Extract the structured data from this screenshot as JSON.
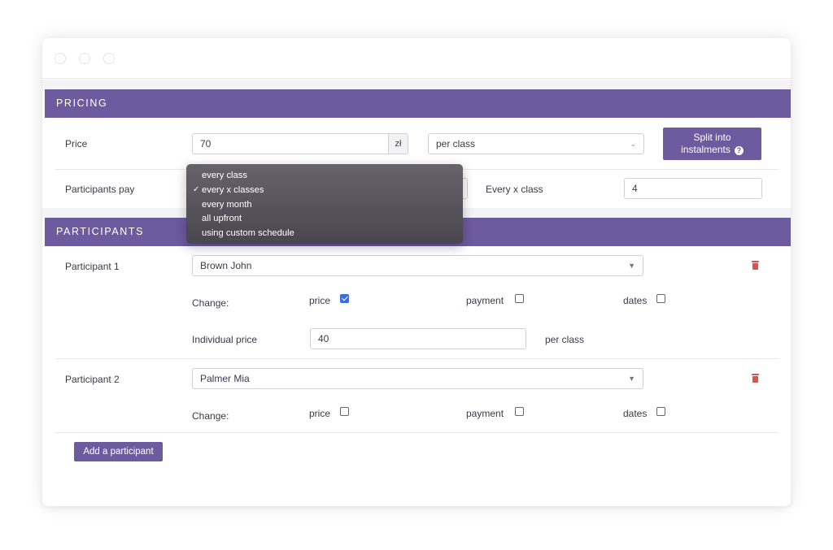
{
  "pricing": {
    "header": "PRICING",
    "price_label": "Price",
    "price_value": "70",
    "currency": "zł",
    "period_select": "per class",
    "split_button_line1": "Split into",
    "split_button_line2": "instalments",
    "participants_pay_label": "Participants pay",
    "every_x_class_label": "Every x class",
    "every_x_class_value": "4",
    "pay_options": [
      {
        "label": "every class",
        "selected": false
      },
      {
        "label": "every x classes",
        "selected": true
      },
      {
        "label": "every month",
        "selected": false
      },
      {
        "label": "all upfront",
        "selected": false
      },
      {
        "label": "using custom schedule",
        "selected": false
      }
    ]
  },
  "participants": {
    "header": "PARTICIPANTS",
    "change_label": "Change:",
    "opt_price": "price",
    "opt_payment": "payment",
    "opt_dates": "dates",
    "items": [
      {
        "label": "Participant 1",
        "name": "Brown John",
        "price_checked": true,
        "payment_checked": false,
        "dates_checked": false,
        "individual_price_label": "Individual price",
        "individual_price_value": "40",
        "individual_price_unit": "per class"
      },
      {
        "label": "Participant 2",
        "name": "Palmer Mia",
        "price_checked": false,
        "payment_checked": false,
        "dates_checked": false
      }
    ],
    "add_button": "Add a participant"
  },
  "icons": {
    "window_dots": "window-control-dot",
    "help": "help-icon",
    "delete": "trash-icon",
    "select_caret": "caret-down-icon",
    "chevron": "chevron-down-icon"
  },
  "colors": {
    "accent": "#6e5a9f",
    "danger": "#d9534f",
    "checkbox_checked": "#3b6fd8"
  }
}
